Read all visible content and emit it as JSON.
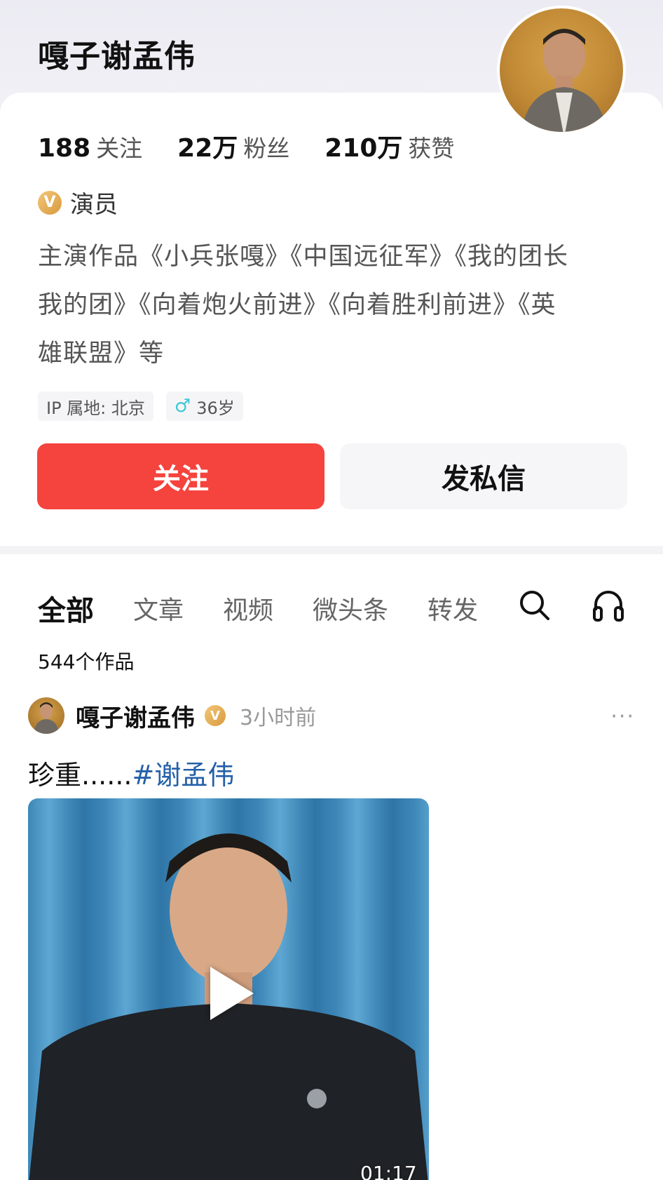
{
  "profile": {
    "name": "嘎子谢孟伟",
    "stats": [
      {
        "num": "188",
        "label": "关注"
      },
      {
        "num": "22万",
        "label": "粉丝"
      },
      {
        "num": "210万",
        "label": "获赞"
      }
    ],
    "verify_badge": "V",
    "verify_label": "演员",
    "bio_lines": [
      "主演作品《小兵张嘎》《中国远征军》《我的团长",
      "我的团》《向着炮火前进》《向着胜利前进》《英",
      "雄联盟》等"
    ],
    "tags": [
      "IP 属地: 北京",
      "36岁"
    ],
    "gender_icon": "male-icon",
    "follow_label": "关注",
    "message_label": "发私信"
  },
  "tabs": [
    "全部",
    "文章",
    "视频",
    "微头条",
    "转发"
  ],
  "icons": {
    "search": "search-icon",
    "listen": "headphones-icon"
  },
  "works_count": "544个作品",
  "post": {
    "author": "嘎子谢孟伟",
    "verify_badge": "V",
    "time": "3小时前",
    "more": "···",
    "text": "珍重......",
    "hashtag": "#谢孟伟",
    "video_duration": "01:17"
  },
  "colors": {
    "follow": "#f5433d",
    "hashtag": "#2560a8",
    "accent_gold": "#d89a3e"
  }
}
